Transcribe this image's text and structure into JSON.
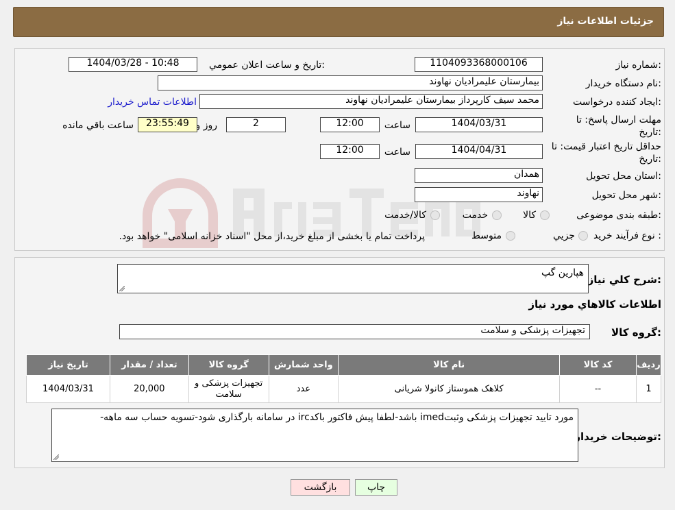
{
  "header": {
    "title": "جزئیات اطلاعات نیاز"
  },
  "details": {
    "need_number_label": "شماره نیاز:",
    "need_number": "1104093368000106",
    "announce_label": "تاریخ و ساعت اعلان عمومي:",
    "announce_value": "1404/03/28 - 10:48",
    "buyer_org_label": "نام دستگاه خریدار:",
    "buyer_org": "بیمارستان علیمرادیان نهاوند",
    "creator_label": "ایجاد کننده درخواست:",
    "creator": "محمد سیف کارپرداز بیمارستان علیمرادیان نهاوند",
    "contact_link": "اطلاعات تماس خریدار",
    "deadline_label_1": "مهلت ارسال پاسخ: تا",
    "deadline_label_2": "تاریخ:",
    "deadline_date": "1404/03/31",
    "time_label": "ساعت",
    "deadline_time": "12:00",
    "days_value": "2",
    "days_label": "روز و",
    "remaining_time": "23:55:49",
    "remaining_label": "ساعت باقي مانده",
    "validity_label_1": "حداقل تاریخ اعتبار قیمت: تا",
    "validity_label_2": "تاریخ:",
    "validity_date": "1404/04/31",
    "validity_time": "12:00",
    "province_label": "استان محل تحویل:",
    "province": "همدان",
    "city_label": "شهر محل تحویل:",
    "city": "نهاوند",
    "category_label": "طبقه بندی موضوعی:",
    "category_options": [
      "کالا",
      "خدمت",
      "کالا/خدمت"
    ],
    "process_label": "نوع فرآیند خرید :",
    "process_options": [
      "جزیي",
      "متوسط"
    ],
    "process_note": "پرداخت تمام یا بخشی از مبلغ خرید،از محل \"اسناد خزانه اسلامی\" خواهد بود."
  },
  "summary": {
    "desc_label": "شرح کلي نیاز:",
    "desc_value": "هپارین گپ",
    "goods_info_title": "اطلاعات کالاهاي مورد نیاز",
    "group_label": "گروه کالا:",
    "group_value": "تجهیزات پزشکی و سلامت"
  },
  "table": {
    "headers": [
      "ردیف",
      "کد کالا",
      "نام کالا",
      "واحد شمارش",
      "گروه کالا",
      "تعداد / مقدار",
      "تاریخ نیاز"
    ],
    "rows": [
      [
        "1",
        "--",
        "کلاهک هموستاز کانولا شریانی",
        "عدد",
        "تجهیزات پزشکی و سلامت",
        "20,000",
        "1404/03/31"
      ]
    ]
  },
  "buyer_notes": {
    "label": "توضیحات خریدار:",
    "value": "مورد تایید تجهیزات پزشکی وثبتimed باشد-لطفا پیش فاکتور باکدirc در سامانه بارگذاری شود-تسویه حساب سه ماهه-"
  },
  "buttons": {
    "print": "چاپ",
    "back": "بازگشت"
  },
  "colors": {
    "header_bg": "#8b6c43",
    "print_bg": "#e6ffe0",
    "back_bg": "#ffe0e0",
    "table_header_bg": "#7a7a7a"
  }
}
